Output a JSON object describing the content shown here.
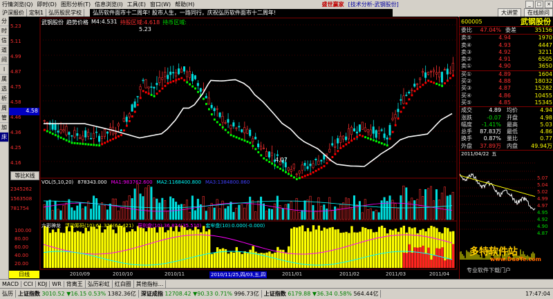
{
  "menu": {
    "items": [
      "行情浏览(Q)",
      "即时(D)",
      "图形分析(T)",
      "信息浏览(I)",
      "工具(E)",
      "窗口(W)",
      "帮助(H)"
    ],
    "brand": "盛世赢家",
    "brand_tag": "[技术分析-武钢股份]"
  },
  "tabs": {
    "items": [
      "沪深报价",
      "定制1",
      "弘历股民学校"
    ],
    "ticker": "弘历软件面市十二周年!    股市人生，一路同行，庆祝弘历软件面市十二周年!",
    "btn_lecture": "大讲堂",
    "btn_online": "在线顾问"
  },
  "leftbar": [
    "分",
    "时",
    "信",
    "道",
    "间",
    "I",
    "属",
    "选",
    "析",
    "周",
    "管",
    "加",
    "床"
  ],
  "chart": {
    "stock": "武钢股份",
    "indicator": "趋势价格",
    "ma_label": "M4:4.531",
    "hold_label": "持股区域:4.618",
    "coin_label": "持币区域:",
    "price_ticks": [
      "5.23",
      "5.11",
      "4.99",
      "4.87",
      "4.75",
      "4.58",
      "4.46",
      "4.36",
      "4.25",
      "4.16"
    ],
    "current_price_tag": "4.58",
    "high_mark": "5.23",
    "low_mark": "4.07",
    "period_btn": "等比K线",
    "vol_label": "VOL(5,10,20)",
    "vol_value": "878343.000",
    "ma1_label": "MA1:983762.600",
    "ma2_label": "MA2:1168400.800",
    "ma3_label": "MA3:1384800.860",
    "vol_ticks": [
      "2345262",
      "1563508",
      "781754"
    ],
    "ind_name": "六彩神龙",
    "ind_a": "浮动筹码(10):61.326(64.421)",
    "ind_b": "获利盘(10):36.874(35.510)",
    "ind_c": "套牢盘(10):0.000(-0.000)",
    "ind_ticks": [
      "100.00",
      "80.00",
      "60.00",
      "40.00",
      "20.00"
    ],
    "period_tab": "日线",
    "date_labels": [
      "2010/09",
      "2010/10",
      "2010/11",
      "2010/12",
      "2011/01",
      "2011/02",
      "2011/03",
      "2011/04"
    ],
    "date_highlight": "2010/11/25,四/03,五,四"
  },
  "quote": {
    "code": "600005",
    "name": "武钢股份",
    "webi_label": "委比",
    "webi_val": "47.04%",
    "weicha_label": "委差",
    "weicha_val": "35156",
    "sells": [
      {
        "l": "卖⑤",
        "p": "4.94",
        "v": "1970"
      },
      {
        "l": "卖④",
        "p": "4.93",
        "v": "4447"
      },
      {
        "l": "卖③",
        "p": "4.92",
        "v": "3211"
      },
      {
        "l": "卖②",
        "p": "4.91",
        "v": "6505"
      },
      {
        "l": "卖①",
        "p": "4.90",
        "v": "3650"
      }
    ],
    "buys": [
      {
        "l": "买①",
        "p": "4.89",
        "v": "1604"
      },
      {
        "l": "买②",
        "p": "4.88",
        "v": "18032"
      },
      {
        "l": "买③",
        "p": "4.87",
        "v": "15282"
      },
      {
        "l": "买④",
        "p": "4.86",
        "v": "10455"
      },
      {
        "l": "买⑤",
        "p": "4.85",
        "v": "15345"
      }
    ],
    "stats": [
      {
        "l": "成交",
        "v": "4.89",
        "l2": "均价",
        "v2": "4.94"
      },
      {
        "l": "涨跌",
        "v": "-0.07",
        "l2": "开盘",
        "v2": "4.98"
      },
      {
        "l": "幅度",
        "v": "-1.41%",
        "l2": "最高",
        "v2": "5.03"
      },
      {
        "l": "总手",
        "v": "87.83万",
        "l2": "最低",
        "v2": "4.86"
      },
      {
        "l": "换手",
        "v": "0.87%",
        "l2": "量比",
        "v2": "0.77"
      },
      {
        "l": "外盘",
        "v": "37.89万",
        "l2": "内盘",
        "v2": "49.94万"
      }
    ],
    "mini_date": "2011/04/22",
    "mini_day": "五",
    "mini_ticks": [
      "5.07",
      "5.04",
      "5.02",
      "4.99",
      "4.97",
      "4.95",
      "4.92",
      "4.90",
      "4.87"
    ],
    "watermark": "多特软件站",
    "watermark_url": "www.DuoTe.com",
    "watermark2": "专业软件下载门户"
  },
  "bottom_tabs": [
    "MACD",
    "CCI",
    "KDJ",
    "WR",
    "背离王",
    "弘历彩虹",
    "红白圈",
    "其他指标..."
  ],
  "status": {
    "sh_label": "上证指数",
    "sh_val": "3010.52",
    "sh_chg": "▼16.15",
    "sh_pct": "0.53%",
    "sh_amt": "1382.36亿",
    "sz_label": "深证成指",
    "sz_val": "12708.42",
    "sz_chg": "▼90.33",
    "sz_pct": "0.71%",
    "sz_amt": "996.73亿",
    "sh2_label": "上证指数",
    "sh2_val": "6179.88",
    "sh2_chg": "▼36.34",
    "sh2_pct": "0.58%",
    "sh2_amt": "564.44亿",
    "time": "17:47:04",
    "hongli": "弘历"
  }
}
